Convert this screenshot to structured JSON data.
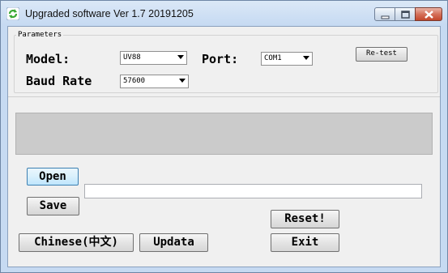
{
  "window": {
    "title": "Upgraded software  Ver 1.7 20191205",
    "icon": "refresh-arrows-icon",
    "controls": [
      "minimize-icon",
      "maximize-icon",
      "close-icon"
    ],
    "accent_close": "#c3472b"
  },
  "parameters": {
    "group_label": "Parameters",
    "model_label": "Model:",
    "model_value": "UV88",
    "port_label": "Port:",
    "port_value": "COM1",
    "baud_label": "Baud Rate",
    "baud_value": "57600",
    "retest_label": "Re-test"
  },
  "progress": {
    "fraction": 0
  },
  "file": {
    "path_value": ""
  },
  "buttons": {
    "open": "Open",
    "save": "Save",
    "reset": "Reset!",
    "chinese": "Chinese(中文)",
    "updata": "Updata",
    "exit": "Exit"
  }
}
